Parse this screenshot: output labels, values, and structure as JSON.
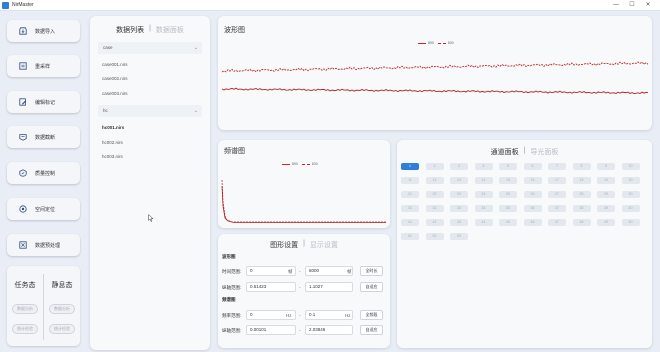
{
  "app": {
    "title": "NirMaster",
    "controls": [
      "—",
      "☐",
      "✕"
    ]
  },
  "nav": {
    "items": [
      {
        "label": "数据导入",
        "icon": "import-icon"
      },
      {
        "label": "重采样",
        "icon": "resample-icon"
      },
      {
        "label": "编辑标记",
        "icon": "edit-mark-icon"
      },
      {
        "label": "数据截断",
        "icon": "truncate-icon"
      },
      {
        "label": "质量控制",
        "icon": "quality-icon"
      },
      {
        "label": "空间定位",
        "icon": "location-icon"
      },
      {
        "label": "数据预处理",
        "icon": "preprocess-icon"
      }
    ],
    "task_state": {
      "title": "任务态",
      "buttons": [
        "数据分析",
        "统计检验"
      ]
    },
    "rest_state": {
      "title": "静息态",
      "buttons": [
        "数据分析",
        "统计检验"
      ]
    }
  },
  "datalist": {
    "title": "数据列表",
    "alt_tab": "数据面板",
    "groups": [
      {
        "name": "case",
        "files": [
          "case001.nirs",
          "case002.nirs",
          "case003.nirs"
        ]
      },
      {
        "name": "hc",
        "files": [
          "hc001.nirs",
          "hc002.nirs",
          "hc003.nirs"
        ]
      }
    ],
    "selected_file": "hc001.nirs"
  },
  "wave": {
    "title": "波形图",
    "legend": [
      "890",
      "830"
    ]
  },
  "freq": {
    "title": "频谱图",
    "legend": [
      "890",
      "830"
    ]
  },
  "graph_settings": {
    "title": "图形设置",
    "alt_tab": "显示设置",
    "wave_section": "波形图",
    "freq_section": "频谱图",
    "wave": {
      "time_label": "时间范围:",
      "time_from": "0",
      "time_to": "6000",
      "time_unit": "帧",
      "time_btn": "全时长",
      "amp_label": "纵轴范围:",
      "amp_from": "0.51423",
      "amp_to": "1.1027",
      "amp_btn": "自适应"
    },
    "freq": {
      "freq_label": "频率范围:",
      "freq_from": "0",
      "freq_to": "0.1",
      "freq_unit": "Hz",
      "freq_btn": "全频段",
      "amp_label": "纵轴范围:",
      "amp_from": "0.00101",
      "amp_to": "2.03846",
      "amp_btn": "自适应"
    }
  },
  "channels": {
    "title": "通道面板",
    "alt_tab": "导光面板",
    "labels": [
      "1",
      "2",
      "3",
      "4",
      "5",
      "6",
      "7",
      "8",
      "9",
      "10",
      "11",
      "12",
      "13",
      "14",
      "15",
      "16",
      "17",
      "18",
      "19",
      "20",
      "21",
      "22",
      "23",
      "24",
      "25",
      "26",
      "27",
      "28",
      "29",
      "30",
      "31",
      "32",
      "33",
      "34",
      "35",
      "36",
      "37",
      "38",
      "39",
      "40",
      "41",
      "42",
      "43",
      "44",
      "45",
      "46",
      "47",
      "48",
      "49",
      "50",
      "51",
      "52",
      "53"
    ],
    "active": "1"
  },
  "colors": {
    "accent": "#2f7fd8",
    "trace": "#c0282a"
  }
}
